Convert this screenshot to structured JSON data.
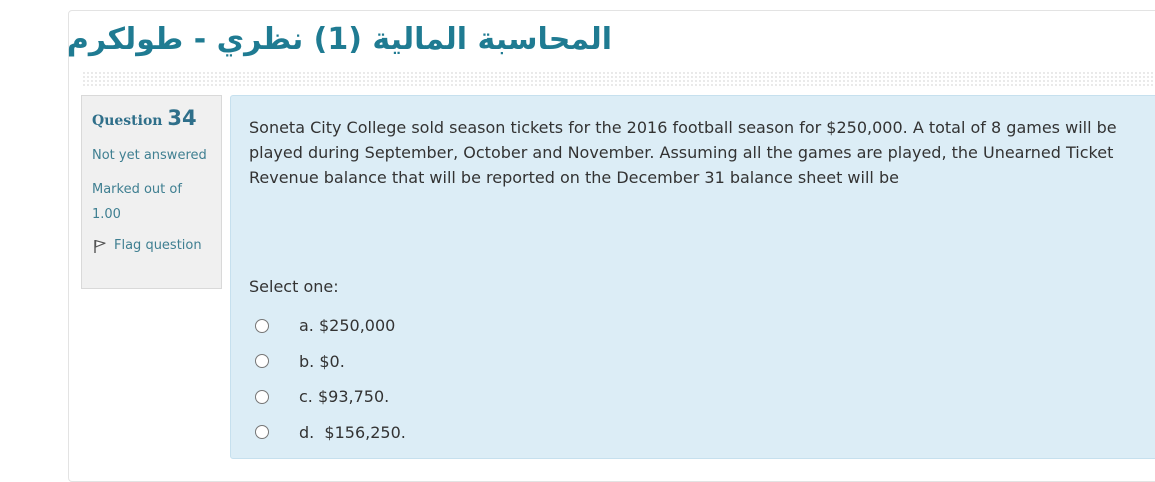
{
  "course": {
    "title": "المحاسبة المالية (1) نظري - طولكرم"
  },
  "question_info": {
    "label": "Question",
    "number": "34",
    "state": "Not yet answered",
    "grade": "Marked out of 1.00",
    "flag_label": "Flag question",
    "flag_icon": "flag-icon"
  },
  "question": {
    "text": "Soneta City College sold season tickets for the 2016 football season for $250,000. A total of 8 games will be played during September, October and November. Assuming all the games are played, the Unearned Ticket Revenue balance that will be reported on the December 31 balance sheet will be",
    "prompt": "Select one:",
    "options": [
      {
        "label": "a. $250,000",
        "selected": false
      },
      {
        "label": "b. $0.",
        "selected": false
      },
      {
        "label": "c. $93,750.",
        "selected": false
      },
      {
        "label": "d.  $156,250.",
        "selected": false
      }
    ]
  },
  "colors": {
    "title": "#1f7b92",
    "question_bg": "#dcedf6",
    "info_bg": "#f0f0f0",
    "info_text": "#3f7f91"
  }
}
